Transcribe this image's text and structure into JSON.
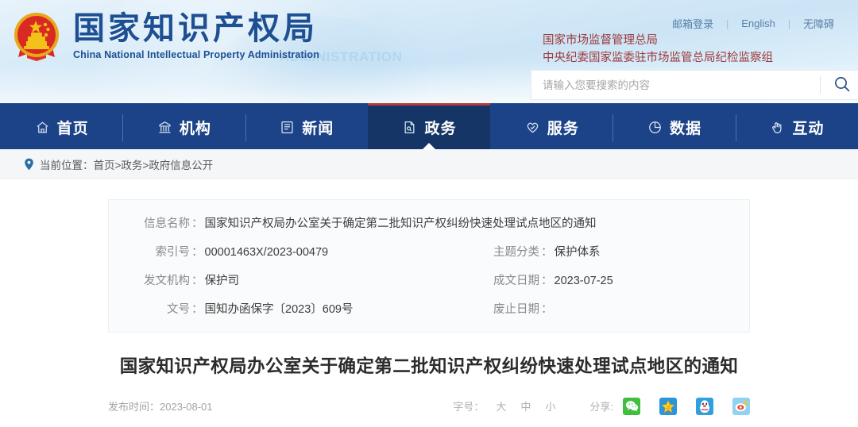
{
  "header": {
    "emblem_alt": "national-emblem",
    "brand_cn": "国家知识产权局",
    "brand_en": "China National Intellectual Property Administration",
    "watermark": "ADMINISTRATION",
    "top_links": [
      {
        "label": "邮箱登录",
        "name": "mail-login-link"
      },
      {
        "label": "English",
        "name": "english-link"
      },
      {
        "label": "无障碍",
        "name": "accessibility-link"
      }
    ],
    "separator": "|",
    "org_lines": [
      "国家市场监督管理总局",
      "中央纪委国家监委驻市场监管总局纪检监察组"
    ],
    "search": {
      "placeholder": "请输入您要搜索的内容",
      "value": "",
      "button_icon": "search-icon"
    }
  },
  "nav": {
    "items": [
      {
        "label": "首页",
        "icon": "home-icon",
        "active": false
      },
      {
        "label": "机构",
        "icon": "bank-icon",
        "active": false
      },
      {
        "label": "新闻",
        "icon": "news-icon",
        "active": false
      },
      {
        "label": "政务",
        "icon": "document-icon",
        "active": true
      },
      {
        "label": "服务",
        "icon": "heart-check-icon",
        "active": false
      },
      {
        "label": "数据",
        "icon": "pie-chart-icon",
        "active": false
      },
      {
        "label": "互动",
        "icon": "hand-icon",
        "active": false
      }
    ],
    "active_color": "#b4393c",
    "bar_color": "#1c4387"
  },
  "breadcrumb": {
    "icon": "location-pin-icon",
    "prefix": "当前位置：",
    "path": "首页>政务>政府信息公开"
  },
  "info": {
    "rows": [
      {
        "cells": [
          {
            "key": "信息名称",
            "value": "国家知识产权局办公室关于确定第二批知识产权纠纷快速处理试点地区的通知",
            "span": "full"
          }
        ]
      },
      {
        "cells": [
          {
            "key": "索引号",
            "value": "00001463X/2023-00479",
            "span": "left"
          },
          {
            "key": "主题分类",
            "value": "保护体系",
            "span": "right"
          }
        ]
      },
      {
        "cells": [
          {
            "key": "发文机构",
            "value": "保护司",
            "span": "left"
          },
          {
            "key": "成文日期",
            "value": "2023-07-25",
            "span": "right"
          }
        ]
      },
      {
        "cells": [
          {
            "key": "文号",
            "value": "国知办函保字〔2023〕609号",
            "span": "left"
          },
          {
            "key": "废止日期",
            "value": "",
            "span": "right"
          }
        ]
      }
    ],
    "colon": "："
  },
  "document": {
    "title": "国家知识产权局办公室关于确定第二批知识产权纠纷快速处理试点地区的通知",
    "publish_label": "发布时间：",
    "publish_date": "2023-08-01"
  },
  "toolbar": {
    "fontsize_label": "字号：",
    "fontsize_options": [
      {
        "label": "大",
        "name": "font-size-large"
      },
      {
        "label": "中",
        "name": "font-size-medium"
      },
      {
        "label": "小",
        "name": "font-size-small"
      }
    ],
    "share_label": "分享:",
    "share_items": [
      {
        "name": "share-wechat-icon",
        "label": "微信"
      },
      {
        "name": "share-qzone-icon",
        "label": "QQ空间"
      },
      {
        "name": "share-qq-icon",
        "label": "QQ"
      },
      {
        "name": "share-weibo-icon",
        "label": "新浪微博"
      }
    ]
  }
}
